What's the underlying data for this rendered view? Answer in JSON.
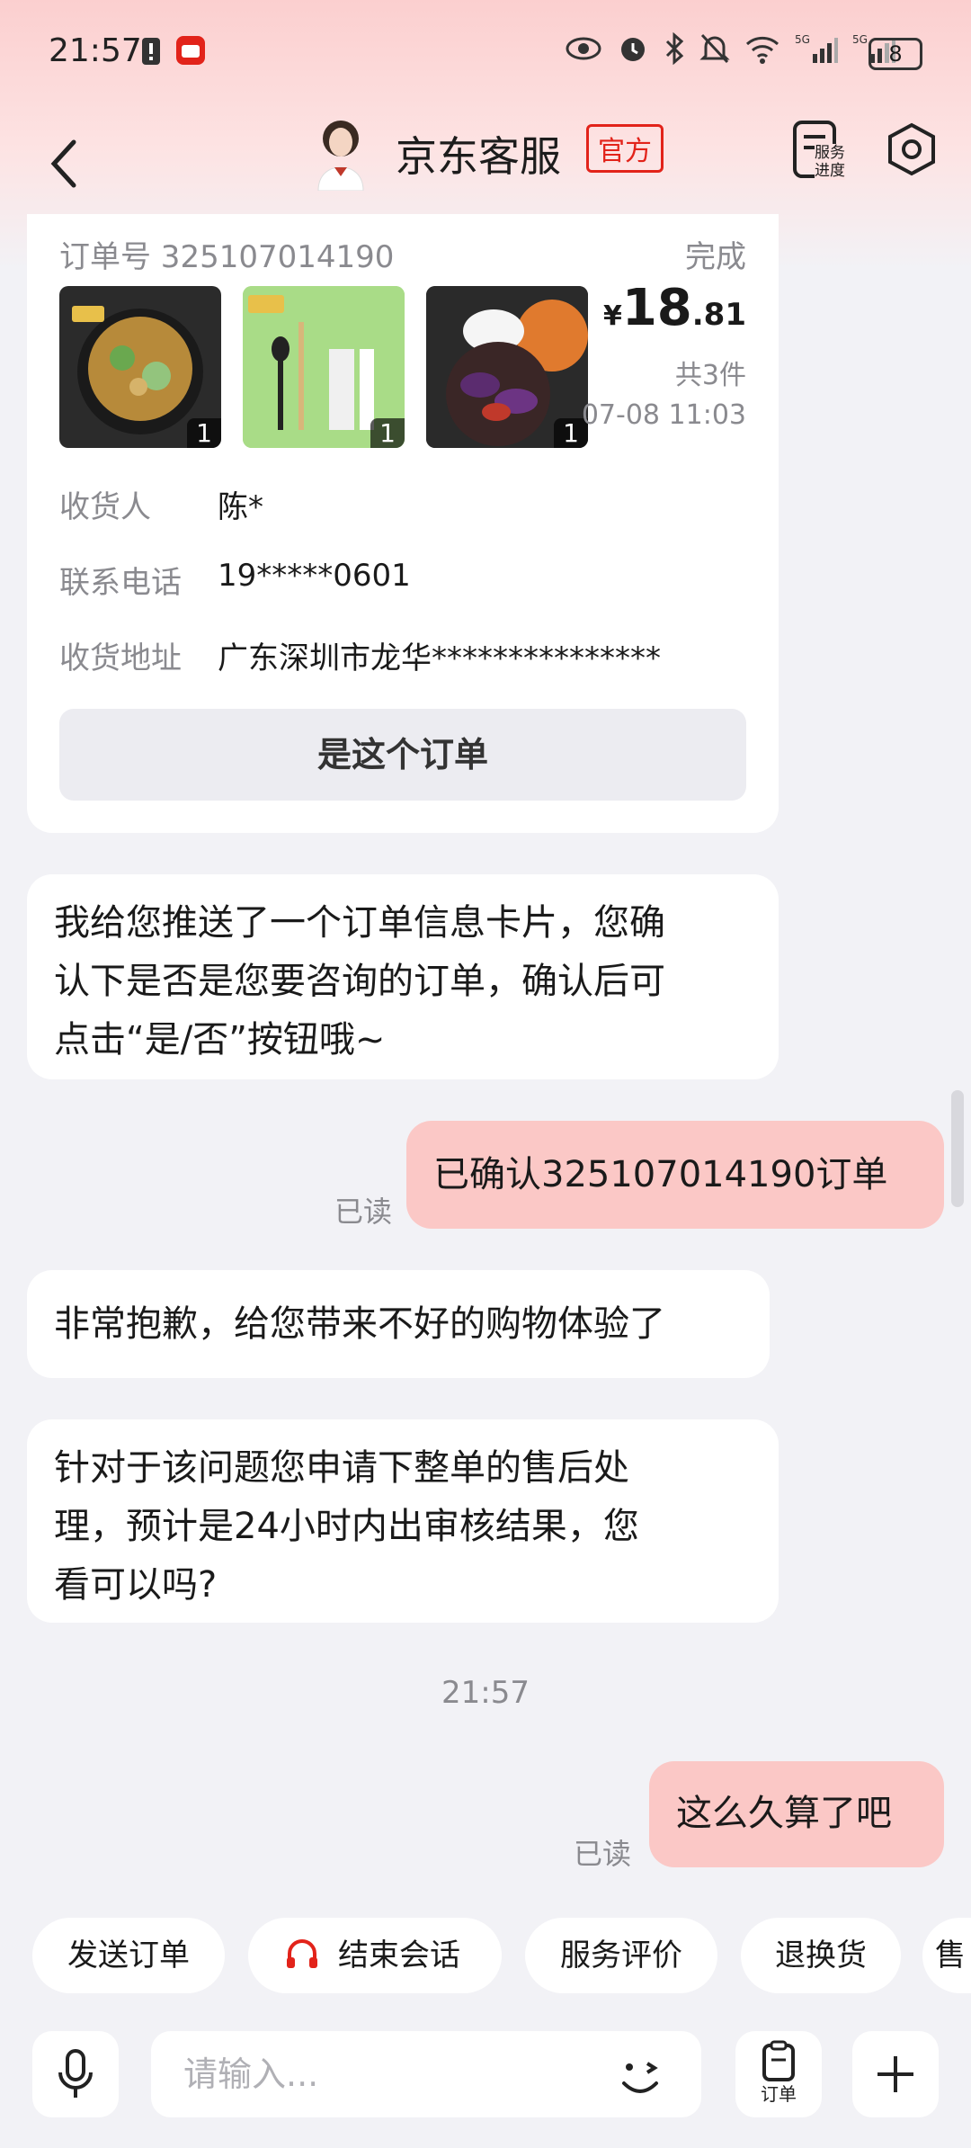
{
  "status_bar": {
    "time": "21:57",
    "battery": "8",
    "network_1": "5G",
    "network_2": "5G"
  },
  "header": {
    "title": "京东客服",
    "badge": "官方",
    "progress_label_1": "服务",
    "progress_label_2": "进度"
  },
  "order_card": {
    "order_no": "订单号 325107014190",
    "status": "完成",
    "items": [
      {
        "qty": "1"
      },
      {
        "qty": "1"
      },
      {
        "qty": "1"
      }
    ],
    "currency": "¥",
    "price_int": "18",
    "price_dec": ".81",
    "item_count": "共3件",
    "time": "07-08 11:03",
    "receiver_label": "收货人",
    "receiver_value": "陈*",
    "phone_label": "联系电话",
    "phone_value": "19*****0601",
    "address_label": "收货地址",
    "address_value": "广东深圳市龙华***************",
    "confirm_button": "是这个订单"
  },
  "messages": {
    "m1_l1": "我给您推送了一个订单信息卡片，您确",
    "m1_l2": "认下是否是您要咨询的订单，确认后可",
    "m1_l3": "点击“是/否”按钮哦~",
    "m2": "已确认325107014190订单",
    "m2_read": "已读",
    "m3": "非常抱歉，给您带来不好的购物体验了",
    "m4_l1": "针对于该问题您申请下整单的售后处",
    "m4_l2": "理，预计是24小时内出审核结果，您",
    "m4_l3": "看可以吗?",
    "timestamp": "21:57",
    "m5": "这么久算了吧",
    "m5_read": "已读"
  },
  "quick_actions": {
    "send_order": "发送订单",
    "end_chat": "结束会话",
    "rate_service": "服务评价",
    "return_exchange": "退换货",
    "partial": "售"
  },
  "input_bar": {
    "placeholder": "请输入...",
    "order_label": "订单"
  },
  "colors": {
    "accent": "#e2231a",
    "outgoing_bubble": "#fbc8c6",
    "background": "#f2f2f6"
  }
}
